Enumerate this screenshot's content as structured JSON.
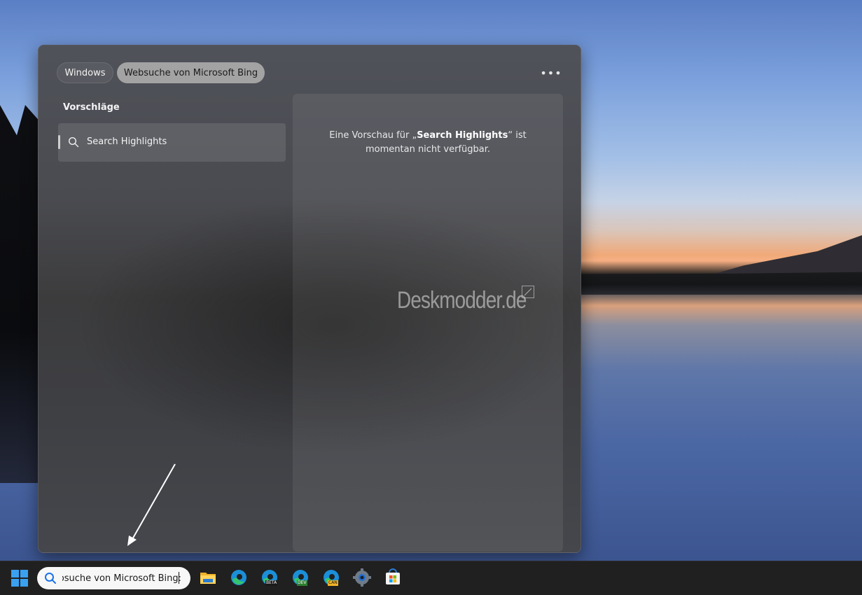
{
  "flyout": {
    "tabs": [
      {
        "label": "Windows"
      },
      {
        "label": "Websuche von Microsoft Bing",
        "selected": true
      }
    ],
    "more_icon": "more-horizontal-icon",
    "suggestions_title": "Vorschläge",
    "suggestions": [
      {
        "label": "Search Highlights",
        "icon": "search-icon"
      }
    ],
    "preview": {
      "text_before": "Eine Vorschau für „",
      "text_bold": "Search Highlights",
      "text_after": "“ ist momentan nicht verfügbar."
    }
  },
  "watermark": {
    "text": "Deskmodder.de"
  },
  "taskbar": {
    "search_text": "Websuche von Microsoft Bing:",
    "apps": [
      {
        "name": "file-explorer-icon"
      },
      {
        "name": "edge-icon"
      },
      {
        "name": "edge-beta-icon",
        "badge": "BETA"
      },
      {
        "name": "edge-dev-icon",
        "badge": "DEV"
      },
      {
        "name": "edge-canary-icon",
        "badge": "CAN"
      },
      {
        "name": "settings-gear-icon"
      },
      {
        "name": "microsoft-store-icon"
      }
    ]
  },
  "colors": {
    "tab_selected_bg": "#a3a3a3",
    "taskbar_bg": "#202020",
    "search_accent": "#1a73e8"
  }
}
